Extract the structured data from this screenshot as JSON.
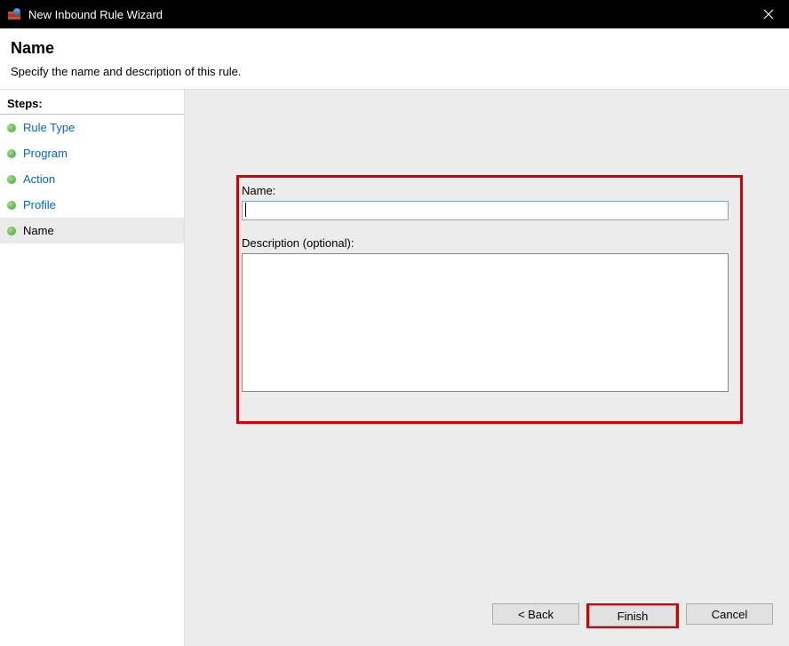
{
  "titlebar": {
    "title": "New Inbound Rule Wizard"
  },
  "header": {
    "title": "Name",
    "subtitle": "Specify the name and description of this rule."
  },
  "sidebar": {
    "stepsHeader": "Steps:",
    "items": [
      {
        "label": "Rule Type"
      },
      {
        "label": "Program"
      },
      {
        "label": "Action"
      },
      {
        "label": "Profile"
      },
      {
        "label": "Name"
      }
    ]
  },
  "form": {
    "nameLabel": "Name:",
    "nameValue": "",
    "descLabel": "Description (optional):",
    "descValue": ""
  },
  "buttons": {
    "back": "< Back",
    "finish": "Finish",
    "cancel": "Cancel"
  }
}
